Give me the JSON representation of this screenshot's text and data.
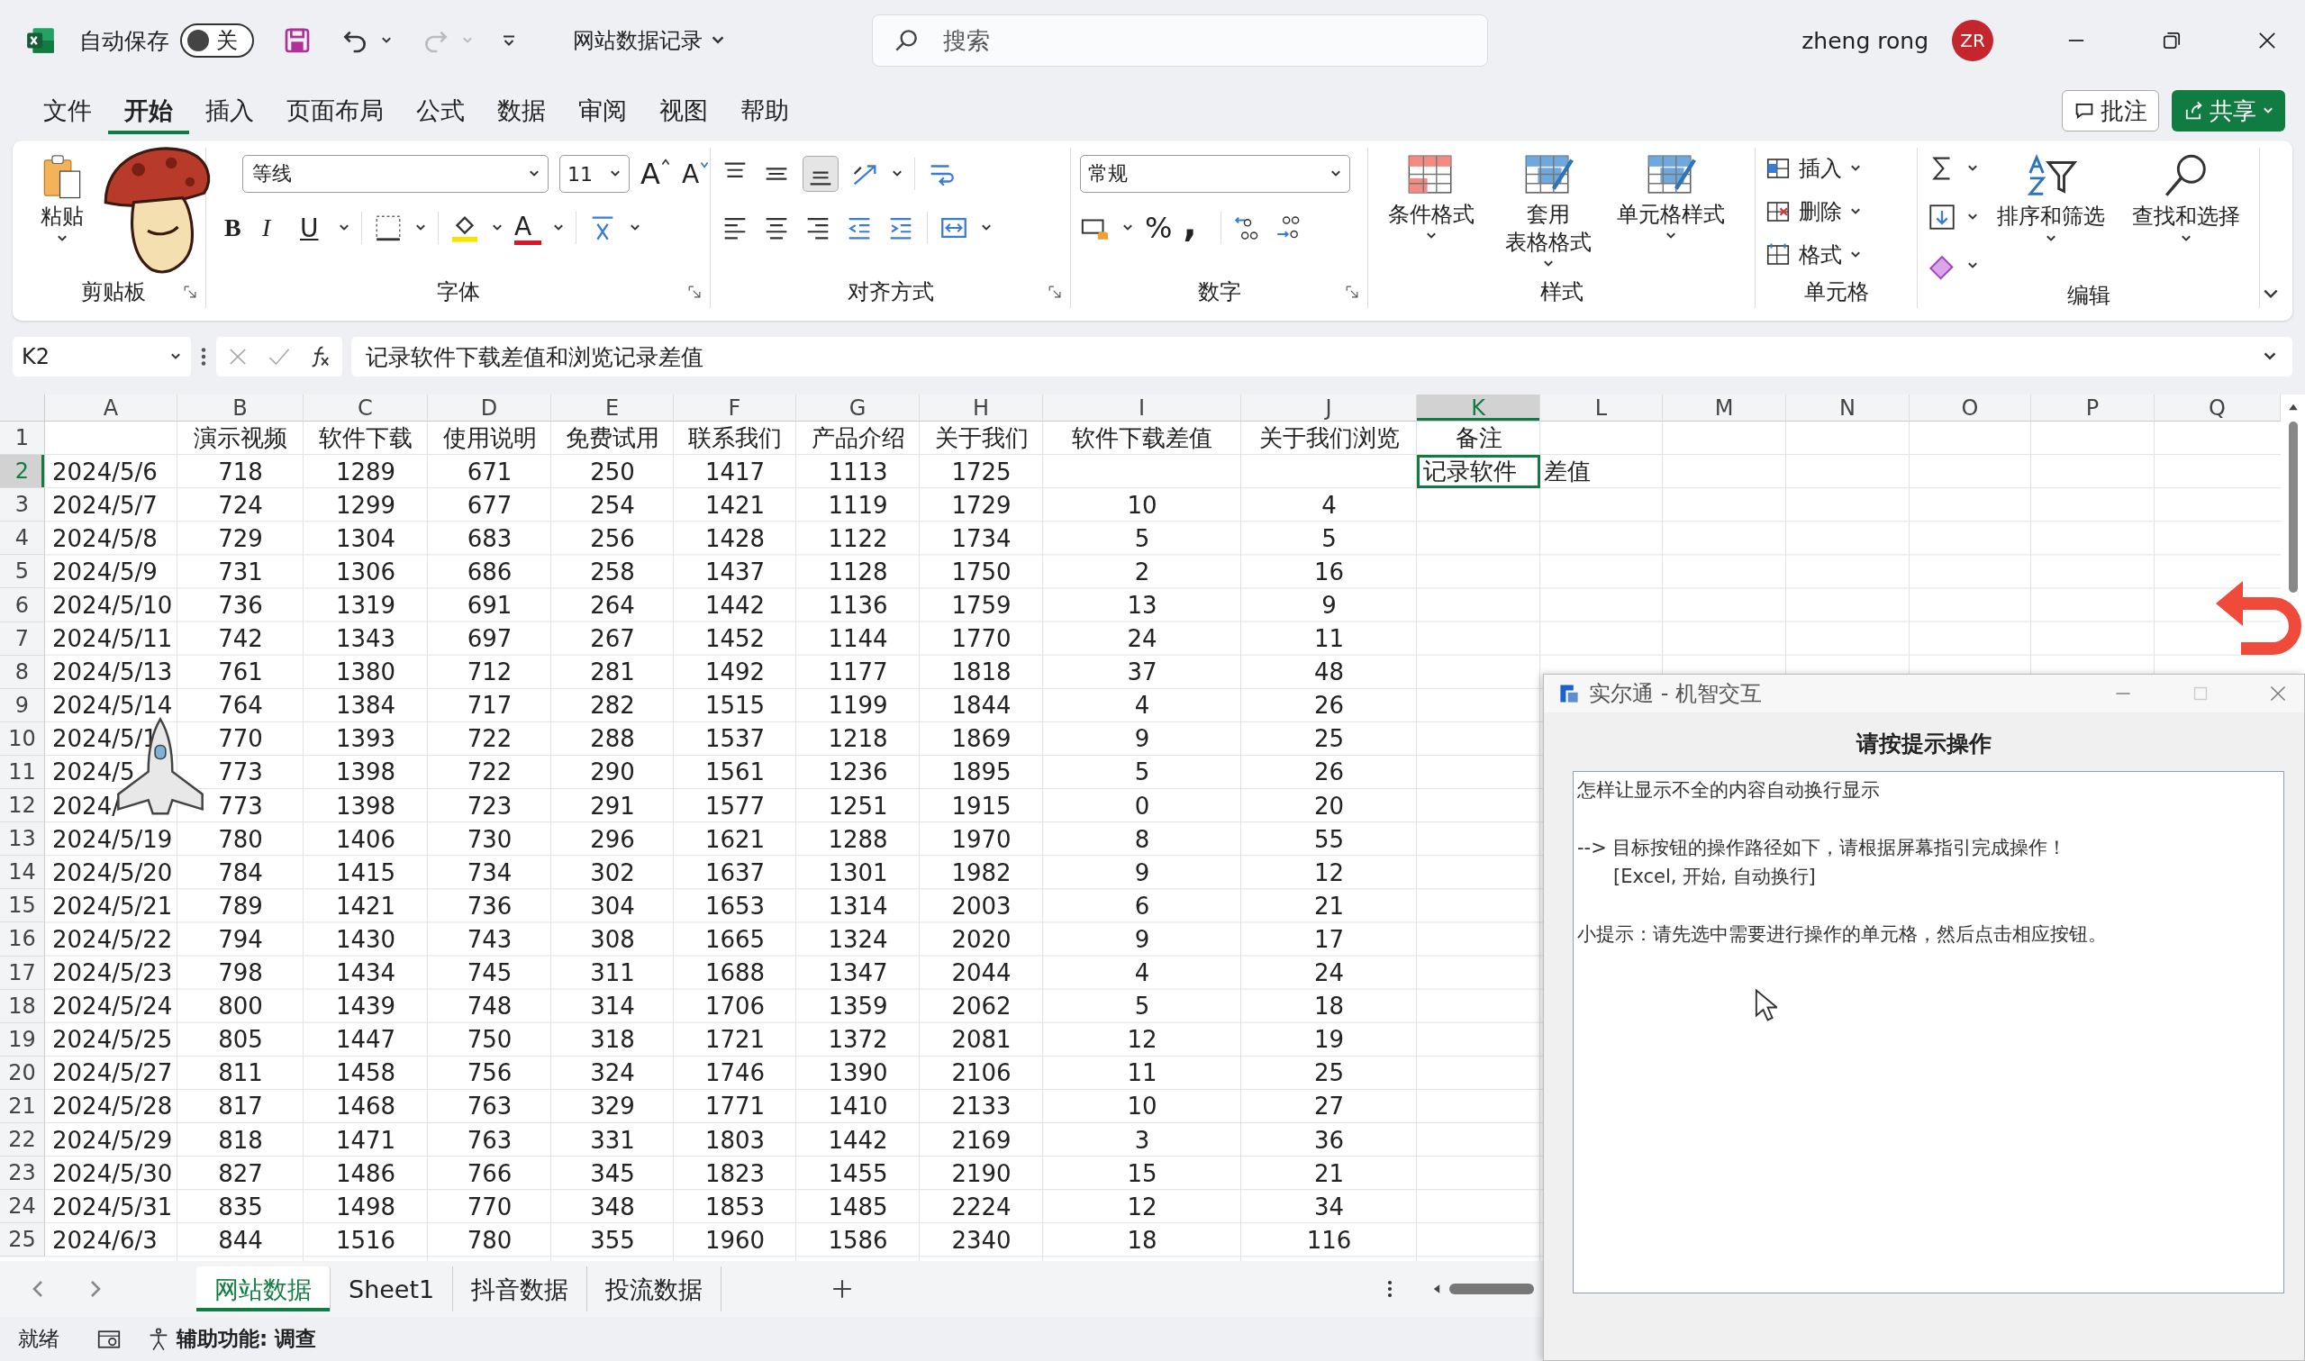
{
  "title_bar": {
    "autosave_label": "自动保存",
    "autosave": {
      "on": false,
      "label": "关"
    },
    "file_name": "网站数据记录",
    "search": {
      "placeholder": "搜索"
    },
    "user_name": "zheng rong",
    "avatar": "ZR"
  },
  "menu": {
    "tabs": [
      {
        "label": "文件",
        "selected": false
      },
      {
        "label": "开始",
        "selected": true
      },
      {
        "label": "插入",
        "selected": false
      },
      {
        "label": "页面布局",
        "selected": false
      },
      {
        "label": "公式",
        "selected": false
      },
      {
        "label": "数据",
        "selected": false
      },
      {
        "label": "审阅",
        "selected": false
      },
      {
        "label": "视图",
        "selected": false
      },
      {
        "label": "帮助",
        "selected": false
      }
    ],
    "comment_button": "批注",
    "share_button": "共享"
  },
  "ribbon": {
    "clipboard": {
      "paste": "粘贴",
      "label": "剪贴板"
    },
    "font": {
      "name": "等线",
      "size": "11",
      "grow": "A",
      "shrink": "A",
      "bold": "B",
      "italic": "I",
      "underline": "U",
      "color_letter": "A",
      "label": "字体"
    },
    "alignment": {
      "label": "对齐方式"
    },
    "number": {
      "format": "常规",
      "percent": "%",
      "comma": ",",
      "label": "数字"
    },
    "styles": {
      "buttons": [
        [
          "条件格式"
        ],
        [
          "套用",
          "表格格式"
        ],
        [
          "单元格样式"
        ]
      ],
      "label": "样式"
    },
    "cells": {
      "buttons": [
        "插入",
        "删除",
        "格式"
      ],
      "label": "单元格"
    },
    "editing": {
      "buttons": [
        "排序和筛选",
        "查找和选择"
      ],
      "label": "编辑"
    }
  },
  "formula_bar": {
    "name_box": "K2",
    "formula": "记录软件下载差值和浏览记录差值"
  },
  "sheet": {
    "columns": [
      {
        "label": "A",
        "selected": false
      },
      {
        "label": "B",
        "selected": false
      },
      {
        "label": "C",
        "selected": false
      },
      {
        "label": "D",
        "selected": false
      },
      {
        "label": "E",
        "selected": false
      },
      {
        "label": "F",
        "selected": false
      },
      {
        "label": "G",
        "selected": false
      },
      {
        "label": "H",
        "selected": false
      },
      {
        "label": "I",
        "selected": false
      },
      {
        "label": "J",
        "selected": false
      },
      {
        "label": "K",
        "selected": true
      },
      {
        "label": "L",
        "selected": false
      },
      {
        "label": "M",
        "selected": false
      },
      {
        "label": "N",
        "selected": false
      },
      {
        "label": "O",
        "selected": false
      },
      {
        "label": "P",
        "selected": false
      },
      {
        "label": "Q",
        "selected": false
      }
    ],
    "rows": [
      {
        "number": "1",
        "selected": false,
        "cells": [
          null,
          "演示视频",
          "软件下载",
          "使用说明",
          "免费试用",
          "联系我们",
          "产品介绍",
          "关于我们",
          "软件下载差值",
          "关于我们浏览",
          "备注"
        ]
      },
      {
        "number": "2",
        "selected": true,
        "cells": [
          "2024/5/6",
          "718",
          "1289",
          "671",
          "250",
          "1417",
          "1113",
          "1725",
          null,
          null,
          "记录软件",
          "差值"
        ]
      },
      {
        "number": "3",
        "selected": false,
        "cells": [
          "2024/5/7",
          "724",
          "1299",
          "677",
          "254",
          "1421",
          "1119",
          "1729",
          "10",
          "4"
        ]
      },
      {
        "number": "4",
        "selected": false,
        "cells": [
          "2024/5/8",
          "729",
          "1304",
          "683",
          "256",
          "1428",
          "1122",
          "1734",
          "5",
          "5"
        ]
      },
      {
        "number": "5",
        "selected": false,
        "cells": [
          "2024/5/9",
          "731",
          "1306",
          "686",
          "258",
          "1437",
          "1128",
          "1750",
          "2",
          "16"
        ]
      },
      {
        "number": "6",
        "selected": false,
        "cells": [
          "2024/5/10",
          "736",
          "1319",
          "691",
          "264",
          "1442",
          "1136",
          "1759",
          "13",
          "9"
        ]
      },
      {
        "number": "7",
        "selected": false,
        "cells": [
          "2024/5/11",
          "742",
          "1343",
          "697",
          "267",
          "1452",
          "1144",
          "1770",
          "24",
          "11"
        ]
      },
      {
        "number": "8",
        "selected": false,
        "cells": [
          "2024/5/13",
          "761",
          "1380",
          "712",
          "281",
          "1492",
          "1177",
          "1818",
          "37",
          "48"
        ]
      },
      {
        "number": "9",
        "selected": false,
        "cells": [
          "2024/5/14",
          "764",
          "1384",
          "717",
          "282",
          "1515",
          "1199",
          "1844",
          "4",
          "26"
        ]
      },
      {
        "number": "10",
        "selected": false,
        "cells": [
          "2024/5/1",
          "770",
          "1393",
          "722",
          "288",
          "1537",
          "1218",
          "1869",
          "9",
          "25"
        ]
      },
      {
        "number": "11",
        "selected": false,
        "cells": [
          "2024/5",
          "773",
          "1398",
          "722",
          "290",
          "1561",
          "1236",
          "1895",
          "5",
          "26"
        ]
      },
      {
        "number": "12",
        "selected": false,
        "cells": [
          "2024/",
          "773",
          "1398",
          "723",
          "291",
          "1577",
          "1251",
          "1915",
          "0",
          "20"
        ]
      },
      {
        "number": "13",
        "selected": false,
        "cells": [
          "2024/5/19",
          "780",
          "1406",
          "730",
          "296",
          "1621",
          "1288",
          "1970",
          "8",
          "55"
        ]
      },
      {
        "number": "14",
        "selected": false,
        "cells": [
          "2024/5/20",
          "784",
          "1415",
          "734",
          "302",
          "1637",
          "1301",
          "1982",
          "9",
          "12"
        ]
      },
      {
        "number": "15",
        "selected": false,
        "cells": [
          "2024/5/21",
          "789",
          "1421",
          "736",
          "304",
          "1653",
          "1314",
          "2003",
          "6",
          "21"
        ]
      },
      {
        "number": "16",
        "selected": false,
        "cells": [
          "2024/5/22",
          "794",
          "1430",
          "743",
          "308",
          "1665",
          "1324",
          "2020",
          "9",
          "17"
        ]
      },
      {
        "number": "17",
        "selected": false,
        "cells": [
          "2024/5/23",
          "798",
          "1434",
          "745",
          "311",
          "1688",
          "1347",
          "2044",
          "4",
          "24"
        ]
      },
      {
        "number": "18",
        "selected": false,
        "cells": [
          "2024/5/24",
          "800",
          "1439",
          "748",
          "314",
          "1706",
          "1359",
          "2062",
          "5",
          "18"
        ]
      },
      {
        "number": "19",
        "selected": false,
        "cells": [
          "2024/5/25",
          "805",
          "1447",
          "750",
          "318",
          "1721",
          "1372",
          "2081",
          "12",
          "19"
        ]
      },
      {
        "number": "20",
        "selected": false,
        "cells": [
          "2024/5/27",
          "811",
          "1458",
          "756",
          "324",
          "1746",
          "1390",
          "2106",
          "11",
          "25"
        ]
      },
      {
        "number": "21",
        "selected": false,
        "cells": [
          "2024/5/28",
          "817",
          "1468",
          "763",
          "329",
          "1771",
          "1410",
          "2133",
          "10",
          "27"
        ]
      },
      {
        "number": "22",
        "selected": false,
        "cells": [
          "2024/5/29",
          "818",
          "1471",
          "763",
          "331",
          "1803",
          "1442",
          "2169",
          "3",
          "36"
        ]
      },
      {
        "number": "23",
        "selected": false,
        "cells": [
          "2024/5/30",
          "827",
          "1486",
          "766",
          "345",
          "1823",
          "1455",
          "2190",
          "15",
          "21"
        ]
      },
      {
        "number": "24",
        "selected": false,
        "cells": [
          "2024/5/31",
          "835",
          "1498",
          "770",
          "348",
          "1853",
          "1485",
          "2224",
          "12",
          "34"
        ]
      },
      {
        "number": "25",
        "selected": false,
        "cells": [
          "2024/6/3",
          "844",
          "1516",
          "780",
          "355",
          "1960",
          "1586",
          "2340",
          "18",
          "116"
        ]
      }
    ]
  },
  "sheet_tabs": [
    {
      "label": "网站数据",
      "selected": true
    },
    {
      "label": "Sheet1",
      "selected": false
    },
    {
      "label": "抖音数据",
      "selected": false
    },
    {
      "label": "投流数据",
      "selected": false
    }
  ],
  "status_bar": {
    "ready": "就绪",
    "accessibility": "辅助功能: 调查"
  },
  "dialog": {
    "title": "实尔通 - 机智交互",
    "heading": "请按提示操作",
    "paragraphs": [
      [
        "怎样让显示不全的内容自动换行显示"
      ],
      [
        "--> 目标按钮的操作路径如下，请根据屏幕指引完成操作！",
        "[Excel, 开始, 自动换行]"
      ],
      [
        "小提示：请先选中需要进行操作的单元格，然后点击相应按钮。"
      ]
    ]
  }
}
